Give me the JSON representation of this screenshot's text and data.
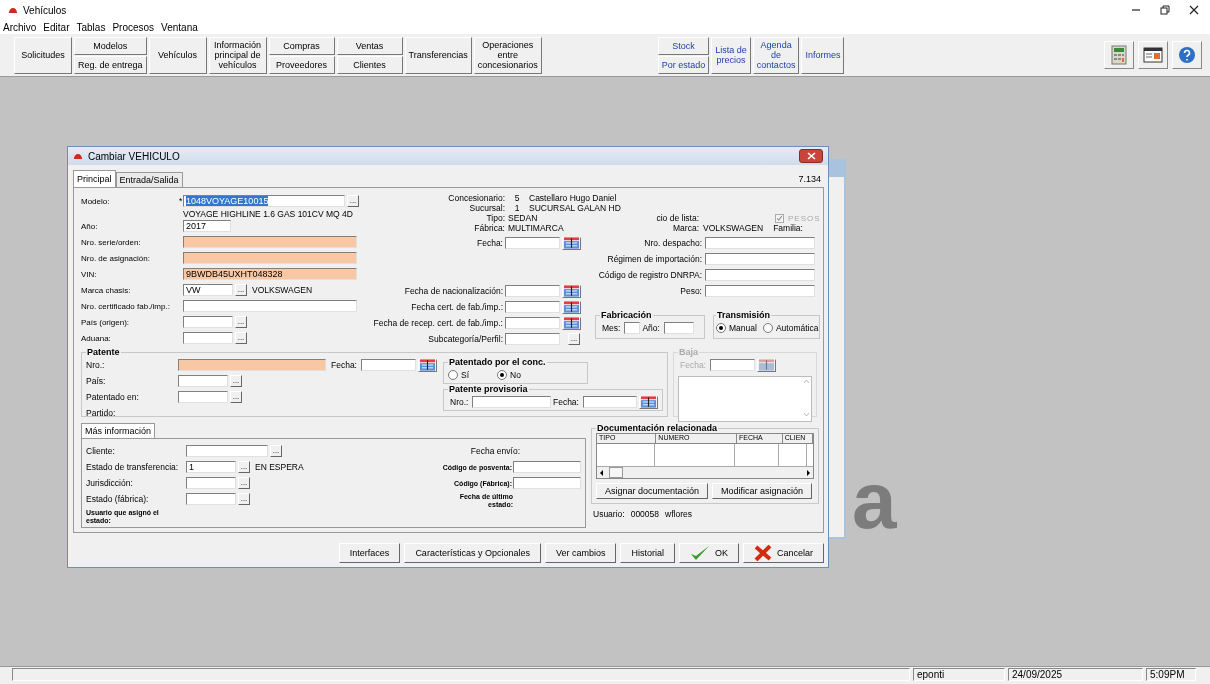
{
  "app_title": "Vehículos",
  "menu": [
    {
      "label": "Archivo"
    },
    {
      "label": "Editar"
    },
    {
      "label": "Tablas"
    },
    {
      "label": "Procesos"
    },
    {
      "label": "Ventana"
    }
  ],
  "toolbar": {
    "main": [
      {
        "kind": "single",
        "lines": [
          "Solicitudes"
        ]
      },
      {
        "kind": "stack",
        "labels": [
          "Modelos",
          "Reg. de entrega"
        ]
      },
      {
        "kind": "single",
        "lines": [
          "Vehículos"
        ]
      },
      {
        "kind": "single",
        "lines": [
          "Información",
          "principal de",
          "vehículos"
        ]
      },
      {
        "kind": "stack",
        "labels": [
          "Compras",
          "Proveedores"
        ]
      },
      {
        "kind": "stack",
        "labels": [
          "Ventas",
          "Clientes"
        ]
      },
      {
        "kind": "single",
        "lines": [
          "Transferencias"
        ]
      },
      {
        "kind": "single",
        "lines": [
          "Operaciones",
          "entre",
          "concesionarios"
        ]
      }
    ],
    "links": [
      {
        "kind": "stack",
        "labels": [
          "Stock",
          "Por estado"
        ]
      },
      {
        "kind": "single",
        "lines": [
          "Lista de",
          "precios"
        ]
      },
      {
        "kind": "single",
        "lines": [
          "Agenda",
          "de",
          "contactos"
        ]
      },
      {
        "kind": "single",
        "lines": [
          "Informes"
        ]
      }
    ]
  },
  "background_logo": "a",
  "dialog": {
    "title": "Cambiar VEHICULO",
    "tabs": [
      {
        "label": "Principal",
        "selected": true
      },
      {
        "label": "Entrada/Salida",
        "selected": false
      }
    ],
    "record_count": "7.134",
    "main_fields": [
      {
        "kind": "lookup_wide",
        "label": "Modelo:",
        "required_mark": "*",
        "value": "1048VOYAGE10015",
        "value_selected": true,
        "button": "..."
      },
      {
        "kind": "note",
        "text": "VOYAGE HIGHLINE 1.6 GAS 101CV MQ 4D"
      },
      {
        "kind": "short",
        "label": "Año:",
        "value": "2017"
      },
      {
        "kind": "wide",
        "label": "Nro. serie/orden:",
        "highlighted": true
      },
      {
        "kind": "wide",
        "label": "Nro. de asignación:",
        "highlighted": true
      },
      {
        "kind": "wide",
        "label": "VIN:",
        "value": "9BWDB45UXHT048328",
        "highlighted": true
      },
      {
        "kind": "lookup",
        "label": "Marca chasis:",
        "value": "VW",
        "button": "...",
        "description": "VOLKSWAGEN"
      },
      {
        "kind": "wide",
        "label": "Nro. certificado fab./imp.:",
        "highlighted": false
      },
      {
        "kind": "lookup",
        "label": "País (origen):",
        "button": "..."
      },
      {
        "kind": "lookup",
        "label": "Aduana:",
        "button": "..."
      }
    ],
    "info": [
      {
        "label": "Concesionario:",
        "code": "5",
        "name": "Castellaro Hugo Daniel"
      },
      {
        "label": "Sucursal:",
        "code": "1",
        "name": "SUCURSAL GALAN HD"
      }
    ],
    "tipo": {
      "label": "Tipo:",
      "value": "SEDAN"
    },
    "price_list": {
      "label": "cio de lista:",
      "checkbox": {
        "label": "PESOS",
        "checked": true,
        "disabled": true
      }
    },
    "fabrica": {
      "label": "Fábrica:",
      "value": "MULTIMARCA"
    },
    "marca": {
      "label": "Marca:",
      "value": "VOLKSWAGEN"
    },
    "familia": {
      "label": "Familia:"
    },
    "date_top": {
      "label": "Fecha:"
    },
    "date_fields": [
      {
        "kind": "date",
        "label": "Fecha de nacionalización:"
      },
      {
        "kind": "date",
        "label": "Fecha cert. de fab./imp.:"
      },
      {
        "kind": "date",
        "label": "Fecha de recep. cert. de fab./imp.:"
      },
      {
        "kind": "lookup",
        "label": "Subcategoría/Perfil:",
        "button": "..."
      }
    ],
    "right_fields": [
      {
        "label": "Nro. despacho:"
      },
      {
        "label": "Régimen de importación:"
      },
      {
        "label": "Código de registro DNRPA:"
      },
      {
        "label": "Peso:"
      }
    ],
    "fabricacion": {
      "title": "Fabricación",
      "month_label": "Mes:",
      "year_label": "Año:"
    },
    "transmision": {
      "title": "Transmisión",
      "options": [
        {
          "label": "Manual",
          "selected": true
        },
        {
          "label": "Automática",
          "selected": false
        }
      ]
    },
    "patente": {
      "title": "Patente",
      "nro_label": "Nro.:",
      "nro_highlighted": true,
      "fecha_label": "Fecha:",
      "pais": {
        "label": "País:",
        "button": "..."
      },
      "patentado_en": {
        "label": "Patentado en:",
        "button": "..."
      },
      "partido_label": "Partido:"
    },
    "patentado_por_conc": {
      "title": "Patentado por el conc.",
      "options": [
        {
          "label": "Sí",
          "selected": false
        },
        {
          "label": "No",
          "selected": true
        }
      ]
    },
    "patente_provisoria": {
      "title": "Patente provisoria",
      "nro_label": "Nro.:",
      "fecha_label": "Fecha:"
    },
    "baja": {
      "title": "Baja",
      "fecha_label": "Fecha:",
      "disabled": true
    },
    "more_tab": {
      "label": "Más información",
      "selected": true
    },
    "more_left": [
      {
        "kind": "lookup_wide",
        "label": "Cliente:",
        "button": "..."
      },
      {
        "kind": "lookup",
        "label": "Estado de transferencia:",
        "value": "1",
        "button": "...",
        "description": "EN ESPERA"
      },
      {
        "kind": "lookup",
        "label": "Jurisdicción:",
        "button": "..."
      },
      {
        "kind": "lookup",
        "label": "Estado (fábrica):",
        "button": "..."
      },
      {
        "kind": "note_label",
        "label": "Usuario que asignó el estado:"
      }
    ],
    "more_right": [
      {
        "kind": "label",
        "label": "Fecha envío:"
      },
      {
        "kind": "field",
        "label": "Código de posventa:"
      },
      {
        "kind": "field",
        "label": "Código (Fábrica):"
      },
      {
        "kind": "note_label",
        "label": "Fecha de último estado:"
      }
    ],
    "documentacion": {
      "title": "Documentación relacionada",
      "columns": [
        "TIPO",
        "NUMERO",
        "FECHA",
        "CLIEN"
      ],
      "buttons": [
        "Asignar documentación",
        "Modificar asignación"
      ]
    },
    "usuario": {
      "label": "Usuario:",
      "code": "000058",
      "name": "wflores"
    },
    "buttons": [
      {
        "kind": "plain",
        "label": "Interfaces"
      },
      {
        "kind": "plain",
        "label": "Características y Opcionales"
      },
      {
        "kind": "plain",
        "label": "Ver cambios"
      },
      {
        "kind": "plain",
        "label": "Historial"
      },
      {
        "kind": "ok",
        "label": "OK"
      },
      {
        "kind": "cancel",
        "label": "Cancelar"
      }
    ]
  },
  "status_bar": [
    "eponti",
    "24/09/2025",
    "5:09PM"
  ]
}
